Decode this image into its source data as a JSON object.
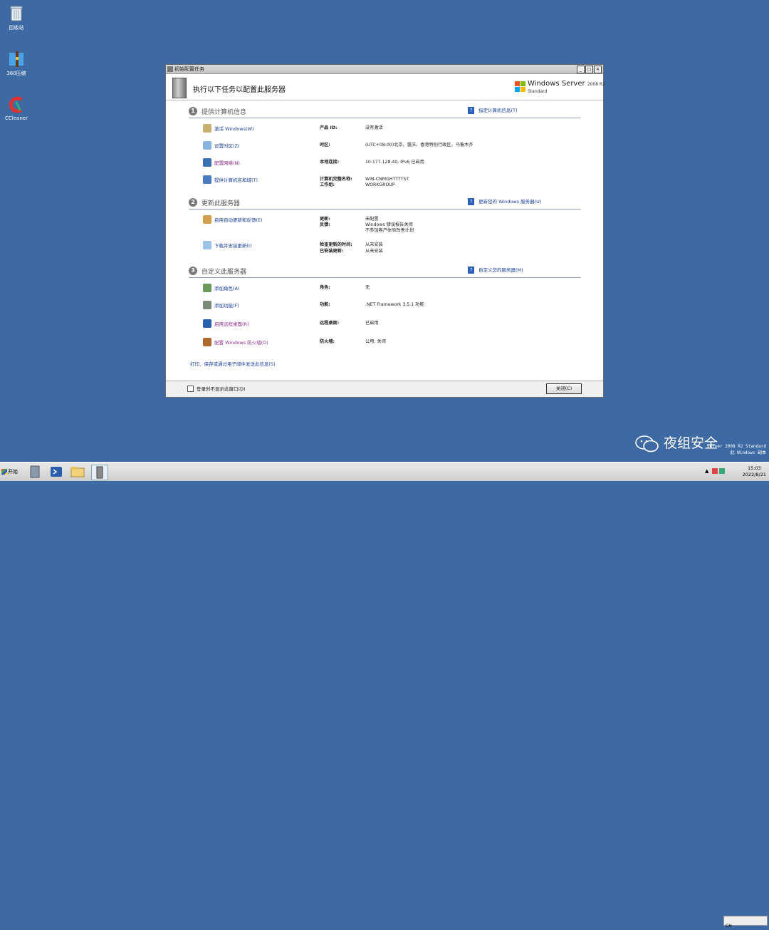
{
  "desktop": {
    "icons": [
      {
        "label": "回收站"
      },
      {
        "label": "360压缩"
      },
      {
        "label": "CCleaner"
      }
    ]
  },
  "window": {
    "title": "初始配置任务",
    "header": "执行以下任务以配置此服务器",
    "brand": {
      "name": "Windows Server",
      "version": "2008 R2",
      "edition": "Standard"
    },
    "sections": [
      {
        "num": "1",
        "title": "提供计算机信息",
        "link": "指定计算机信息(T)",
        "tasks": [
          {
            "label": "激活 Windows(W)",
            "props": [
              {
                "k": "产品 ID:",
                "v": "没有激活"
              }
            ]
          },
          {
            "label": "设置时区(Z)",
            "props": [
              {
                "k": "时区:",
                "v": "(UTC+08:00)北京，重庆，香港特别行政区，乌鲁木齐"
              }
            ]
          },
          {
            "label": "配置网络(N)",
            "props": [
              {
                "k": "本地连接:",
                "v": "10.177.128.40, IPv6 已启用"
              }
            ]
          },
          {
            "label": "提供计算机名和域(T)",
            "props": [
              {
                "k": "计算机完整名称:",
                "v": "WIN-CNMGHTTTT57"
              },
              {
                "k": "工作组:",
                "v": "WORKGROUP"
              }
            ]
          }
        ]
      },
      {
        "num": "2",
        "title": "更新此服务器",
        "link": "更新您的 Windows 服务器(U)",
        "tasks": [
          {
            "label": "启用自动更新和反馈(E)",
            "props": [
              {
                "k": "更新:",
                "v": "未配置"
              },
              {
                "k": "反馈:",
                "v": "Windows 错误报告关闭"
              },
              {
                "k": "",
                "v": "不参加客户体验改善计划"
              }
            ]
          },
          {
            "label": "下载并安装更新(I)",
            "props": [
              {
                "k": "检查更新的时间:",
                "v": "从未安装"
              },
              {
                "k": "已安装更新:",
                "v": "从未安装"
              }
            ]
          }
        ]
      },
      {
        "num": "3",
        "title": "自定义此服务器",
        "link": "自定义您的服务器(M)",
        "tasks": [
          {
            "label": "添加角色(A)",
            "props": [
              {
                "k": "角色:",
                "v": "无"
              }
            ]
          },
          {
            "label": "添加功能(F)",
            "props": [
              {
                "k": "功能:",
                "v": ".NET Framework 3.5.1 功能"
              }
            ]
          },
          {
            "label": "启用远程桌面(R)",
            "props": [
              {
                "k": "远程桌面:",
                "v": "已启用"
              }
            ]
          },
          {
            "label": "配置 Windows 防火墙(O)",
            "props": [
              {
                "k": "防火墙:",
                "v": "公用: 关闭"
              }
            ]
          }
        ]
      }
    ],
    "print_link": "打印、保存或通过电子邮件发送此信息(S)",
    "dont_show": "登录时不显示此窗口(D)",
    "close_button": "关闭(C)"
  },
  "taskbar": {
    "start": "开始",
    "lang": "CH",
    "time": "15:03",
    "date": "2022/8/21"
  },
  "watermark": "夜组安全",
  "bginfo": [
    "Server 2008 R2 Standard",
    "此 Windows 副本"
  ],
  "colors": {
    "desktop": "#3e6aa3",
    "link": "#1a3f9a",
    "visited_link": "#8a2a8a"
  }
}
